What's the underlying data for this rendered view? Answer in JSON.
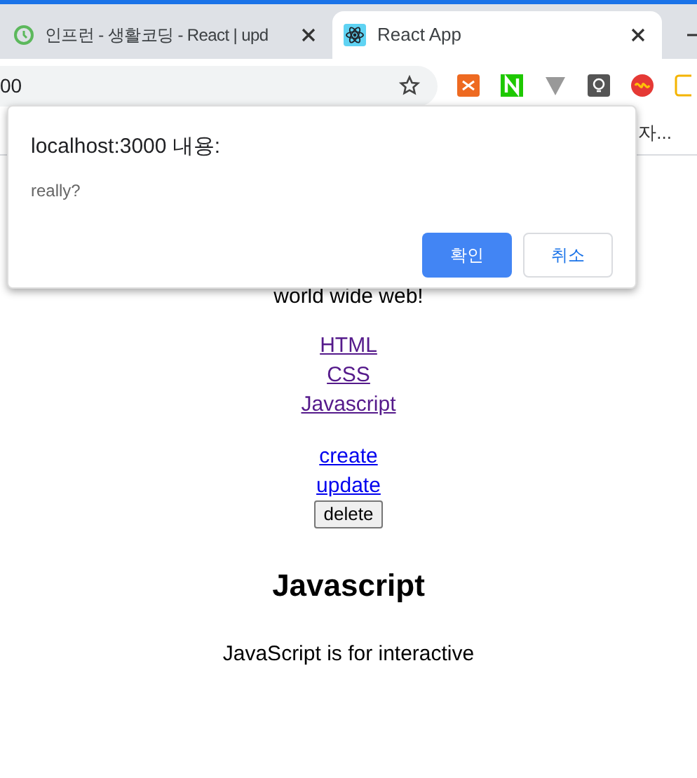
{
  "tabs": [
    {
      "title": "인프런 - 생활코딩 - React | upd",
      "selected": false
    },
    {
      "title": "React App",
      "selected": true
    }
  ],
  "address": "00",
  "bookmarks": [
    "자..."
  ],
  "dialog": {
    "title": "localhost:3000 내용:",
    "message": "really?",
    "buttons": [
      {
        "label": "확인",
        "primary": true
      },
      {
        "label": "취소",
        "primary": false
      }
    ]
  },
  "page": {
    "intro": "world wide web!",
    "links": [
      {
        "label": "HTML",
        "visited": true
      },
      {
        "label": "CSS",
        "visited": true
      },
      {
        "label": "Javascript",
        "visited": true
      }
    ],
    "actions": [
      {
        "label": "create",
        "kind": "link"
      },
      {
        "label": "update",
        "kind": "link"
      },
      {
        "label": "delete",
        "kind": "button"
      }
    ],
    "heading": "Javascript",
    "paragraph": "JavaScript is for interactive"
  }
}
